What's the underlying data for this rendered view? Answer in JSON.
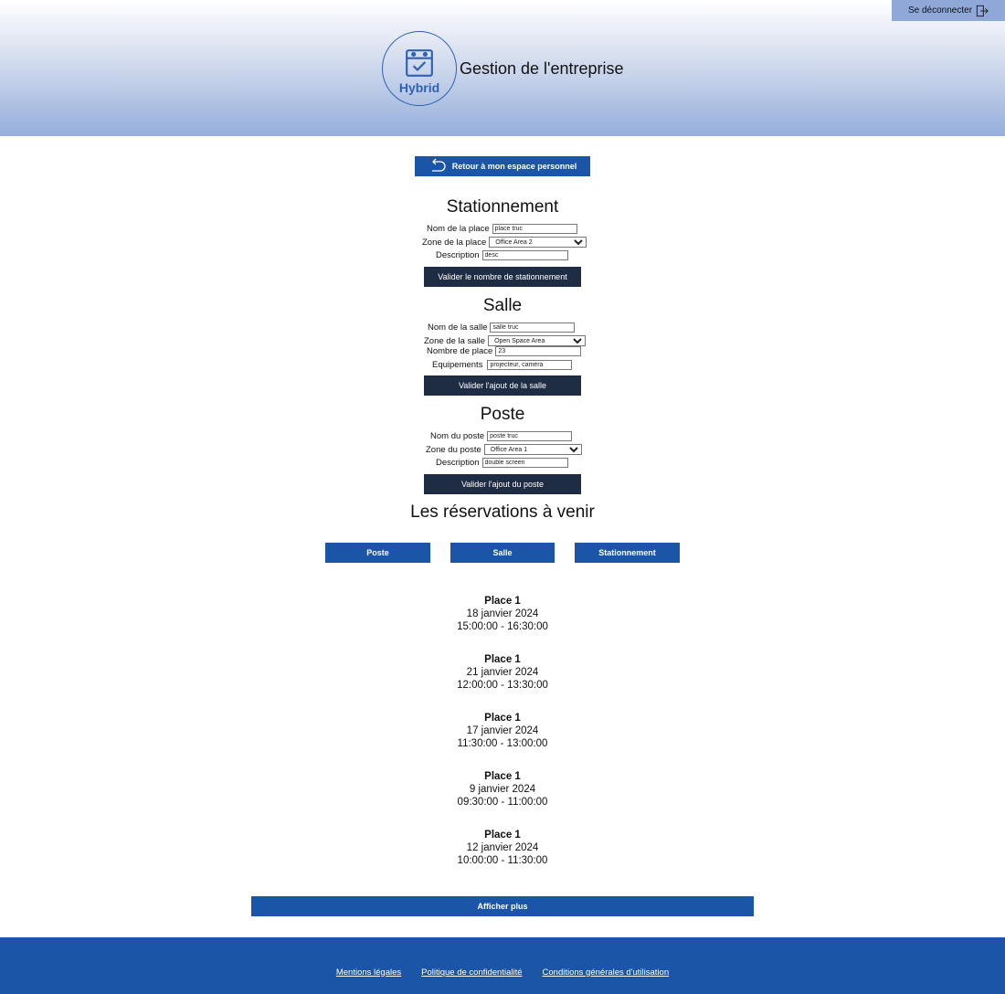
{
  "header": {
    "logout_label": "Se déconnecter",
    "logo_text": "Hybrid",
    "title": "Gestion de l'entreprise"
  },
  "back_button": {
    "label": "Retour à mon espace personnel"
  },
  "parking": {
    "title": "Stationnement",
    "name_label": "Nom de la place",
    "name_value": "place truc",
    "zone_label": "Zone de la place",
    "zone_value": "Office Area 2",
    "description_label": "Description",
    "description_value": "desc",
    "submit_label": "Valider le nombre de stationnement"
  },
  "room": {
    "title": "Salle",
    "name_label": "Nom de la salle",
    "name_value": "salle truc",
    "zone_label": "Zone de la salle",
    "zone_value": "Open Space Area",
    "seats_label": "Nombre de place",
    "seats_value": "23",
    "equipment_label": "Equipements",
    "equipment_value": "projecteur, caméra",
    "submit_label": "Valider l'ajout de la salle"
  },
  "desk": {
    "title": "Poste",
    "name_label": "Nom du poste",
    "name_value": "poste truc",
    "zone_label": "Zone du poste",
    "zone_value": "Office Area 1",
    "description_label": "Description",
    "description_value": "double screen",
    "submit_label": "Valider l'ajout du poste"
  },
  "reservations": {
    "title": "Les réservations à venir",
    "tabs": [
      "Poste",
      "Salle",
      "Stationnement"
    ],
    "items": [
      {
        "title": "Place 1",
        "date": "18 janvier 2024",
        "time": "15:00:00 - 16:30:00"
      },
      {
        "title": "Place 1",
        "date": "21 janvier 2024",
        "time": "12:00:00 - 13:30:00"
      },
      {
        "title": "Place 1",
        "date": "17 janvier 2024",
        "time": "11:30:00 - 13:00:00"
      },
      {
        "title": "Place 1",
        "date": "9 janvier 2024",
        "time": "09:30:00 - 11:00:00"
      },
      {
        "title": "Place 1",
        "date": "12 janvier 2024",
        "time": "10:00:00 - 11:30:00"
      }
    ],
    "more_label": "Afficher plus"
  },
  "footer": {
    "links": [
      "Mentions légales",
      "Politique de confidentialité",
      "Conditions générales d'utilisation"
    ]
  },
  "colors": {
    "primary_blue": "#1b55a8",
    "dark_button": "#1f2d44",
    "logout_bg": "#8fa8d8"
  }
}
